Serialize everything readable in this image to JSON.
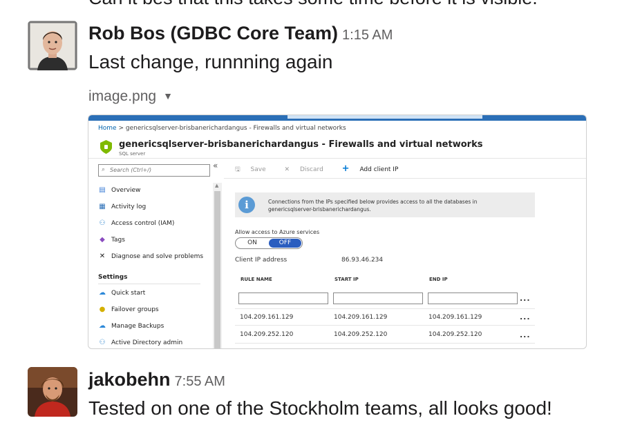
{
  "previous_line": "Can it bes that this takes some time before it is visible.",
  "messages": [
    {
      "sender": "Rob Bos (GDBC Core Team)",
      "time": "1:15 AM",
      "text": "Last change, runnning again",
      "file_name": "image.png"
    },
    {
      "sender": "jakobehn",
      "time": "7:55 AM",
      "text": "Tested on one of the Stockholm teams, all looks good!"
    }
  ],
  "attachment": {
    "breadcrumb_home": "Home",
    "breadcrumb_rest": "genericsqlserver-brisbanerichardangus - Firewalls and virtual networks",
    "title": "genericsqlserver-brisbanerichardangus - Firewalls and virtual networks",
    "subtitle": "SQL server",
    "search_placeholder": "Search (Ctrl+/)",
    "nav_items": [
      "Overview",
      "Activity log",
      "Access control (IAM)",
      "Tags",
      "Diagnose and solve problems"
    ],
    "settings_heading": "Settings",
    "settings_items": [
      "Quick start",
      "Failover groups",
      "Manage Backups",
      "Active Directory admin"
    ],
    "toolbar": {
      "save": "Save",
      "discard": "Discard",
      "add_client_ip": "Add client IP"
    },
    "info_line1": "Connections from the IPs specified below provides access to all the databases in",
    "info_line2": "genericsqlserver-brisbanerichardangus.",
    "allow_label": "Allow access to Azure services",
    "toggle_on": "ON",
    "toggle_off": "OFF",
    "client_ip_label": "Client IP address",
    "client_ip_value": "86.93.46.234",
    "columns": [
      "RULE NAME",
      "START IP",
      "END IP"
    ],
    "rows": [
      [
        "104.209.161.129",
        "104.209.161.129",
        "104.209.161.129"
      ],
      [
        "104.209.252.120",
        "104.209.252.120",
        "104.209.252.120"
      ]
    ],
    "ellipsis": "..."
  },
  "colors": {
    "azure_blue": "#2b6fb7",
    "toggle_active": "#2a5dbf",
    "info_blue": "#5b9bd5"
  }
}
